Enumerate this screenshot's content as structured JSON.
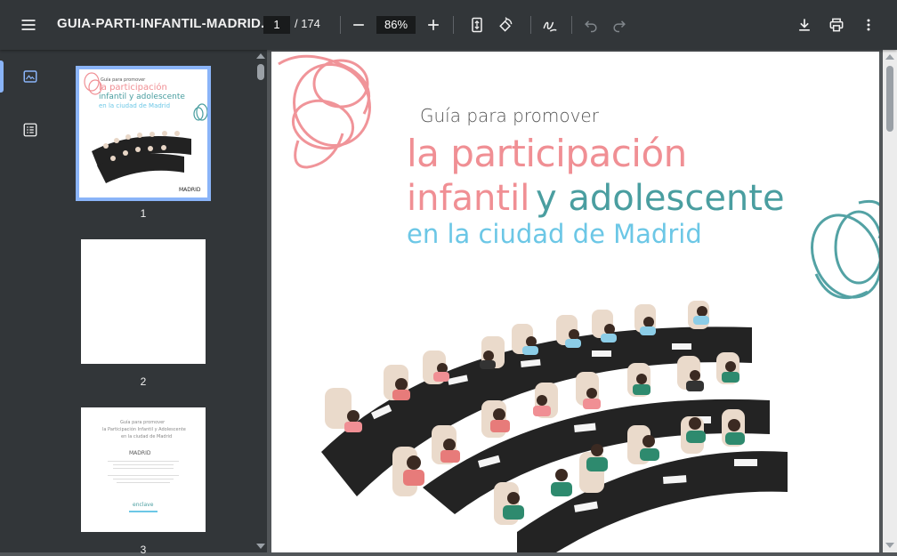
{
  "toolbar": {
    "title": "GUIA-PARTI-INFANTIL-MADRID...",
    "page_current": "1",
    "page_total": "/ 174",
    "zoom": "86%",
    "menu_icon": "menu-icon",
    "zoom_out_icon": "minus-icon",
    "zoom_in_icon": "plus-icon",
    "fit_icon": "fit-page-icon",
    "rotate_icon": "rotate-icon",
    "annotate_icon": "draw-icon",
    "undo_icon": "undo-icon",
    "redo_icon": "redo-icon",
    "download_icon": "download-icon",
    "print_icon": "print-icon",
    "more_icon": "more-vert-icon"
  },
  "sidebar": {
    "thumbnails_icon": "image-icon",
    "outline_icon": "list-icon",
    "thumbnails": [
      {
        "number": "1"
      },
      {
        "number": "2"
      },
      {
        "number": "3"
      }
    ],
    "thumb1_text": {
      "guia": "Guía para promover",
      "l1": "la participación",
      "l2": "infantil y adolescente",
      "l3": "en la ciudad de Madrid",
      "madrid": "MADRID"
    },
    "thumb3_text": {
      "line1": "Guía para promover",
      "line2": "la Participación Infantil y Adolescente",
      "line3": "en la ciudad de Madrid",
      "madrid": "MADRID",
      "logo": "enclave"
    }
  },
  "cover": {
    "guia": "Guía para promover",
    "line1": "la participación",
    "line2a": "infantil",
    "line2b": "y adolescente",
    "line3": "en la ciudad de Madrid"
  },
  "colors": {
    "pink": "#f08f94",
    "teal": "#4a9ea0",
    "light_blue": "#6cc7e6",
    "accent": "#8ab4f8"
  }
}
